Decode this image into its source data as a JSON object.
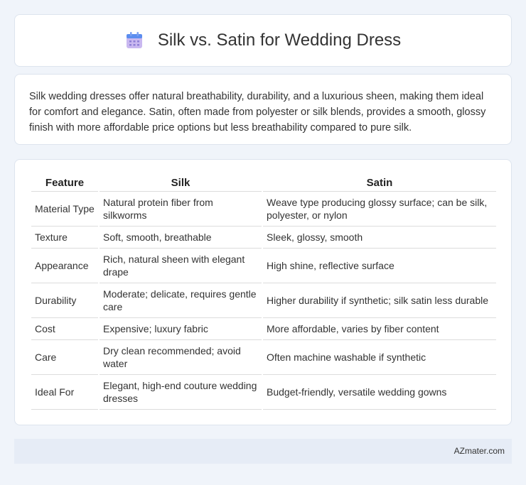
{
  "header": {
    "title": "Silk vs. Satin for Wedding Dress",
    "icon": "calendar-icon"
  },
  "intro": {
    "text": "Silk wedding dresses offer natural breathability, durability, and a luxurious sheen, making them ideal for comfort and elegance. Satin, often made from polyester or silk blends, provides a smooth, glossy finish with more affordable price options but less breathability compared to pure silk."
  },
  "table": {
    "headers": [
      "Feature",
      "Silk",
      "Satin"
    ],
    "rows": [
      [
        "Material Type",
        "Natural protein fiber from silkworms",
        "Weave type producing glossy surface; can be silk, polyester, or nylon"
      ],
      [
        "Texture",
        "Soft, smooth, breathable",
        "Sleek, glossy, smooth"
      ],
      [
        "Appearance",
        "Rich, natural sheen with elegant drape",
        "High shine, reflective surface"
      ],
      [
        "Durability",
        "Moderate; delicate, requires gentle care",
        "Higher durability if synthetic; silk satin less durable"
      ],
      [
        "Cost",
        "Expensive; luxury fabric",
        "More affordable, varies by fiber content"
      ],
      [
        "Care",
        "Dry clean recommended; avoid water",
        "Often machine washable if synthetic"
      ],
      [
        "Ideal For",
        "Elegant, high-end couture wedding dresses",
        "Budget-friendly, versatile wedding gowns"
      ]
    ]
  },
  "footer": {
    "brand": "AZmater.com"
  },
  "colors": {
    "background": "#f0f4fa",
    "card": "#ffffff",
    "footer_bg": "#e6ecf6",
    "icon_top": "#5b8def",
    "icon_body": "#c9b8f0"
  }
}
